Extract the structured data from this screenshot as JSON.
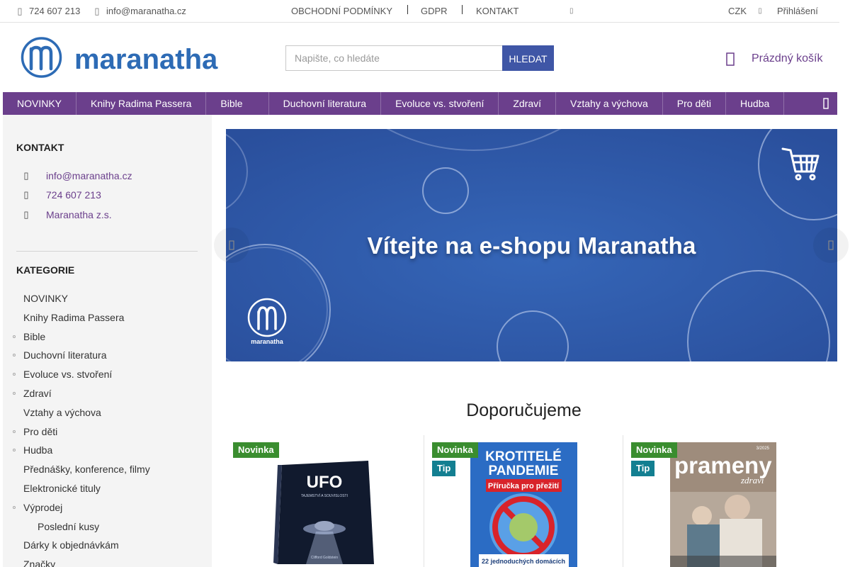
{
  "topbar": {
    "phone": "724 607 213",
    "email": "info@maranatha.cz",
    "links": [
      "OBCHODNÍ PODMÍNKY",
      "GDPR",
      "KONTAKT"
    ],
    "currency": "CZK",
    "login": "Přihlášení"
  },
  "header": {
    "logo_text": "maranatha",
    "search_placeholder": "Napište, co hledáte",
    "search_button": "HLEDAT",
    "cart_label": "Prázdný košík"
  },
  "nav": {
    "items": [
      "NOVINKY",
      "Knihy Radima Passera",
      "Bible",
      "Duchovní literatura",
      "Evoluce vs. stvoření",
      "Zdraví",
      "Vztahy a výchova",
      "Pro děti",
      "Hudba"
    ]
  },
  "sidebar": {
    "contact_title": "KONTAKT",
    "contact": {
      "email": "info@maranatha.cz",
      "phone": "724 607 213",
      "org": "Maranatha z.s."
    },
    "categories_title": "KATEGORIE",
    "categories": [
      {
        "label": "NOVINKY",
        "bullet": false
      },
      {
        "label": "Knihy Radima Passera",
        "bullet": false
      },
      {
        "label": "Bible",
        "bullet": true
      },
      {
        "label": "Duchovní literatura",
        "bullet": true
      },
      {
        "label": "Evoluce vs. stvoření",
        "bullet": true
      },
      {
        "label": "Zdraví",
        "bullet": true
      },
      {
        "label": "Vztahy a výchova",
        "bullet": false
      },
      {
        "label": "Pro děti",
        "bullet": true
      },
      {
        "label": "Hudba",
        "bullet": true
      },
      {
        "label": "Přednášky, konference, filmy",
        "bullet": false
      },
      {
        "label": "Elektronické tituly",
        "bullet": false
      },
      {
        "label": "Výprodej",
        "bullet": true
      },
      {
        "label": "Poslední kusy",
        "bullet": false
      },
      {
        "label": "Dárky k objednávkám",
        "bullet": false
      },
      {
        "label": "Značky",
        "bullet": false
      }
    ]
  },
  "hero": {
    "title": "Vítejte na e-shopu Maranatha",
    "logo_caption": "maranatha"
  },
  "recommended": {
    "title": "Doporučujeme",
    "products": [
      {
        "badges": [
          "Novinka"
        ],
        "cover_title": "UFO",
        "cover_subtitle": "TAJEMSTVÍ A SOUVISLOSTI",
        "cover_author": "Clifford Goldstein"
      },
      {
        "badges": [
          "Novinka",
          "Tip"
        ],
        "cover_title_1": "KROTITELÉ",
        "cover_title_2": "PANDEMIE",
        "cover_subtitle": "Příručka pro přežití",
        "cover_footer": "22 jednoduchých domácích"
      },
      {
        "badges": [
          "Novinka",
          "Tip"
        ],
        "cover_title": "prameny",
        "cover_subtitle": "zdraví",
        "cover_issue": "3/2025"
      }
    ]
  },
  "colors": {
    "brand_purple": "#6b3f8c",
    "search_blue": "#3f56a6",
    "hero_blue": "#2f5aa8",
    "badge_new": "#3a8d2f",
    "badge_tip": "#137f91"
  }
}
